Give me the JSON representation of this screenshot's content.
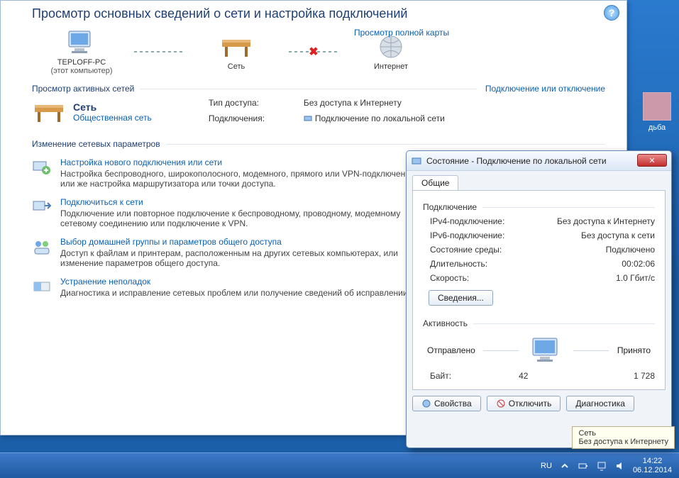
{
  "cp": {
    "title": "Просмотр основных сведений о сети и настройка подключений",
    "full_map": "Просмотр полной карты",
    "nodes": {
      "pc": {
        "name": "TEPLOFF-PC",
        "sub": "(этот компьютер)"
      },
      "net": {
        "name": "Сеть"
      },
      "internet": {
        "name": "Интернет"
      }
    },
    "active_hdr": "Просмотр активных сетей",
    "connect_disconnect": "Подключение или отключение",
    "network": {
      "name": "Сеть",
      "type": "Общественная сеть"
    },
    "access_type_k": "Тип доступа:",
    "access_type_v": "Без доступа к Интернету",
    "connections_k": "Подключения:",
    "connections_v": "Подключение по локальной сети",
    "change_hdr": "Изменение сетевых параметров",
    "opts": [
      {
        "title": "Настройка нового подключения или сети",
        "desc": "Настройка беспроводного, широкополосного, модемного, прямого или VPN-подключения или же настройка маршрутизатора или точки доступа."
      },
      {
        "title": "Подключиться к сети",
        "desc": "Подключение или повторное подключение к беспроводному, проводному, модемному сетевому соединению или подключение к VPN."
      },
      {
        "title": "Выбор домашней группы и параметров общего доступа",
        "desc": "Доступ к файлам и принтерам, расположенным на других сетевых компьютерах, или изменение параметров общего доступа."
      },
      {
        "title": "Устранение неполадок",
        "desc": "Диагностика и исправление сетевых проблем или получение сведений об исправлении."
      }
    ]
  },
  "dlg": {
    "title": "Состояние - Подключение по локальной сети",
    "tab": "Общие",
    "grp_conn": "Подключение",
    "ipv4_k": "IPv4-подключение:",
    "ipv4_v": "Без доступа к Интернету",
    "ipv6_k": "IPv6-подключение:",
    "ipv6_v": "Без доступа к сети",
    "media_k": "Состояние среды:",
    "media_v": "Подключено",
    "dur_k": "Длительность:",
    "dur_v": "00:02:06",
    "spd_k": "Скорость:",
    "spd_v": "1.0 Гбит/с",
    "details_btn": "Сведения...",
    "grp_act": "Активность",
    "sent_lbl": "Отправлено",
    "recv_lbl": "Принято",
    "bytes_k": "Байт:",
    "bytes_sent": "42",
    "bytes_recv": "1 728",
    "btn_props": "Свойства",
    "btn_disable": "Отключить",
    "btn_diag": "Диагностика"
  },
  "desktop": {
    "icon_label": "дьба"
  },
  "tooltip": {
    "l1": "Сеть",
    "l2": "Без доступа к Интернету"
  },
  "tray": {
    "lang": "RU",
    "time": "14:22",
    "date": "06.12.2014"
  }
}
